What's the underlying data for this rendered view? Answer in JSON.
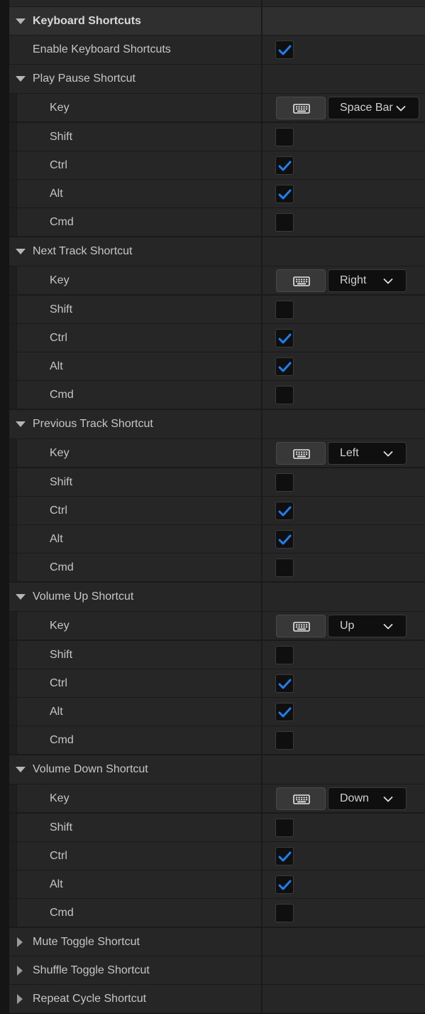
{
  "category": {
    "title": "Keyboard Shortcuts"
  },
  "enable": {
    "label": "Enable Keyboard Shortcuts",
    "checked": true
  },
  "groups": [
    {
      "title": "Play Pause Shortcut",
      "key_label": "Key",
      "key_value": "Space Bar",
      "modifiers": [
        {
          "label": "Shift",
          "checked": false
        },
        {
          "label": "Ctrl",
          "checked": true
        },
        {
          "label": "Alt",
          "checked": true
        },
        {
          "label": "Cmd",
          "checked": false
        }
      ]
    },
    {
      "title": "Next Track Shortcut",
      "key_label": "Key",
      "key_value": "Right",
      "modifiers": [
        {
          "label": "Shift",
          "checked": false
        },
        {
          "label": "Ctrl",
          "checked": true
        },
        {
          "label": "Alt",
          "checked": true
        },
        {
          "label": "Cmd",
          "checked": false
        }
      ]
    },
    {
      "title": "Previous Track Shortcut",
      "key_label": "Key",
      "key_value": "Left",
      "modifiers": [
        {
          "label": "Shift",
          "checked": false
        },
        {
          "label": "Ctrl",
          "checked": true
        },
        {
          "label": "Alt",
          "checked": true
        },
        {
          "label": "Cmd",
          "checked": false
        }
      ]
    },
    {
      "title": "Volume Up Shortcut",
      "key_label": "Key",
      "key_value": "Up",
      "modifiers": [
        {
          "label": "Shift",
          "checked": false
        },
        {
          "label": "Ctrl",
          "checked": true
        },
        {
          "label": "Alt",
          "checked": true
        },
        {
          "label": "Cmd",
          "checked": false
        }
      ]
    },
    {
      "title": "Volume Down Shortcut",
      "key_label": "Key",
      "key_value": "Down",
      "modifiers": [
        {
          "label": "Shift",
          "checked": false
        },
        {
          "label": "Ctrl",
          "checked": true
        },
        {
          "label": "Alt",
          "checked": true
        },
        {
          "label": "Cmd",
          "checked": false
        }
      ]
    }
  ],
  "collapsed_groups": [
    {
      "title": "Mute Toggle Shortcut"
    },
    {
      "title": "Shuffle Toggle Shortcut"
    },
    {
      "title": "Repeat Cycle Shortcut"
    }
  ],
  "icons": {
    "expand": "triangle-down-icon",
    "collapse": "triangle-right-icon",
    "check": "checkmark-icon",
    "keyboard": "keyboard-icon",
    "dropdown": "chevron-down-icon"
  },
  "colors": {
    "check": "#1e7ff0",
    "background": "#262626",
    "category": "#2f2f2f"
  }
}
